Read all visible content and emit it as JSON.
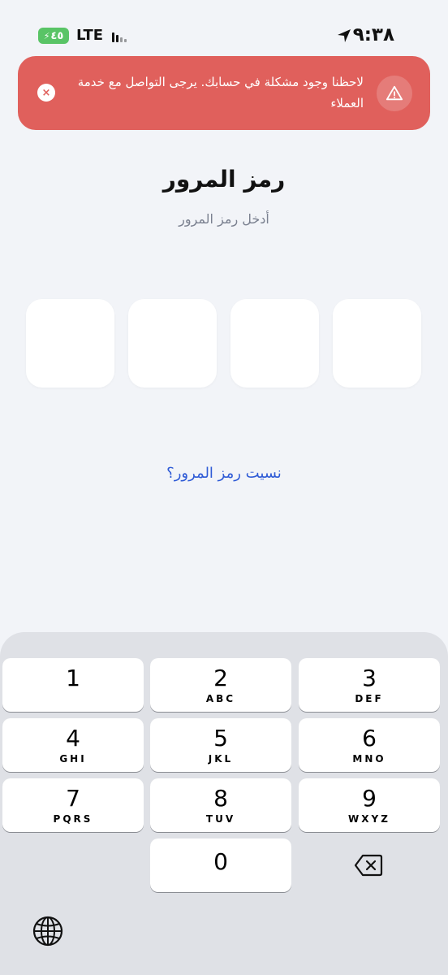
{
  "status_bar": {
    "battery": "٤٥",
    "network": "LTE",
    "time": "٩:٣٨"
  },
  "alert": {
    "message": "لاحظنا وجود مشكلة في حسابك. يرجى التواصل مع خدمة العملاء",
    "close_glyph": "×",
    "color": "#e0605c"
  },
  "header": {
    "title": "رمز المرور",
    "subtitle": "أدخل رمز المرور"
  },
  "pin": {
    "length": 4
  },
  "forgot_link": "نسيت رمز المرور؟",
  "keypad": {
    "keys": [
      {
        "digit": "1",
        "letters": ""
      },
      {
        "digit": "2",
        "letters": "ABC"
      },
      {
        "digit": "3",
        "letters": "DEF"
      },
      {
        "digit": "4",
        "letters": "GHI"
      },
      {
        "digit": "5",
        "letters": "JKL"
      },
      {
        "digit": "6",
        "letters": "MNO"
      },
      {
        "digit": "7",
        "letters": "PQRS"
      },
      {
        "digit": "8",
        "letters": "TUV"
      },
      {
        "digit": "9",
        "letters": "WXYZ"
      },
      {
        "digit": "0",
        "letters": ""
      }
    ],
    "icons": [
      "backspace-icon",
      "globe-icon"
    ]
  }
}
